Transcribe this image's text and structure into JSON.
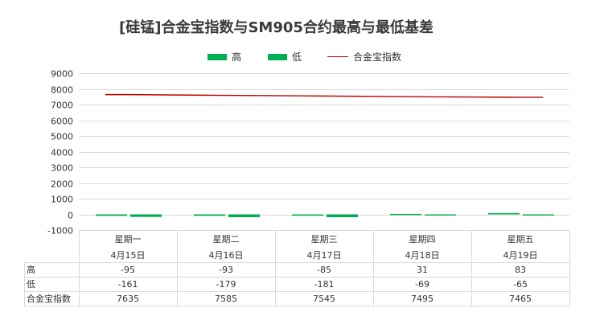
{
  "chart_data": {
    "type": "bar",
    "title": "[硅锰]合金宝指数与SM905合约最高与最低基差",
    "categories": [
      {
        "day": "星期一",
        "date": "4月15日"
      },
      {
        "day": "星期二",
        "date": "4月16日"
      },
      {
        "day": "星期三",
        "date": "4月17日"
      },
      {
        "day": "星期四",
        "date": "4月18日"
      },
      {
        "day": "星期五",
        "date": "4月19日"
      }
    ],
    "series": [
      {
        "name": "高",
        "kind": "bar",
        "color": "#00b050",
        "values": [
          -95,
          -93,
          -85,
          31,
          83
        ]
      },
      {
        "name": "低",
        "kind": "bar",
        "color": "#00b050",
        "values": [
          -161,
          -179,
          -181,
          -69,
          -65
        ]
      },
      {
        "name": "合金宝指数",
        "kind": "line",
        "color": "#c00000",
        "values": [
          7635,
          7585,
          7545,
          7495,
          7465
        ]
      }
    ],
    "ylim": [
      -1000,
      9000
    ],
    "yticks": [
      "9000",
      "8000",
      "7000",
      "6000",
      "5000",
      "4000",
      "3000",
      "2000",
      "1000",
      "0",
      "-1000"
    ],
    "grid": true,
    "legend": "top",
    "data_table": true
  }
}
